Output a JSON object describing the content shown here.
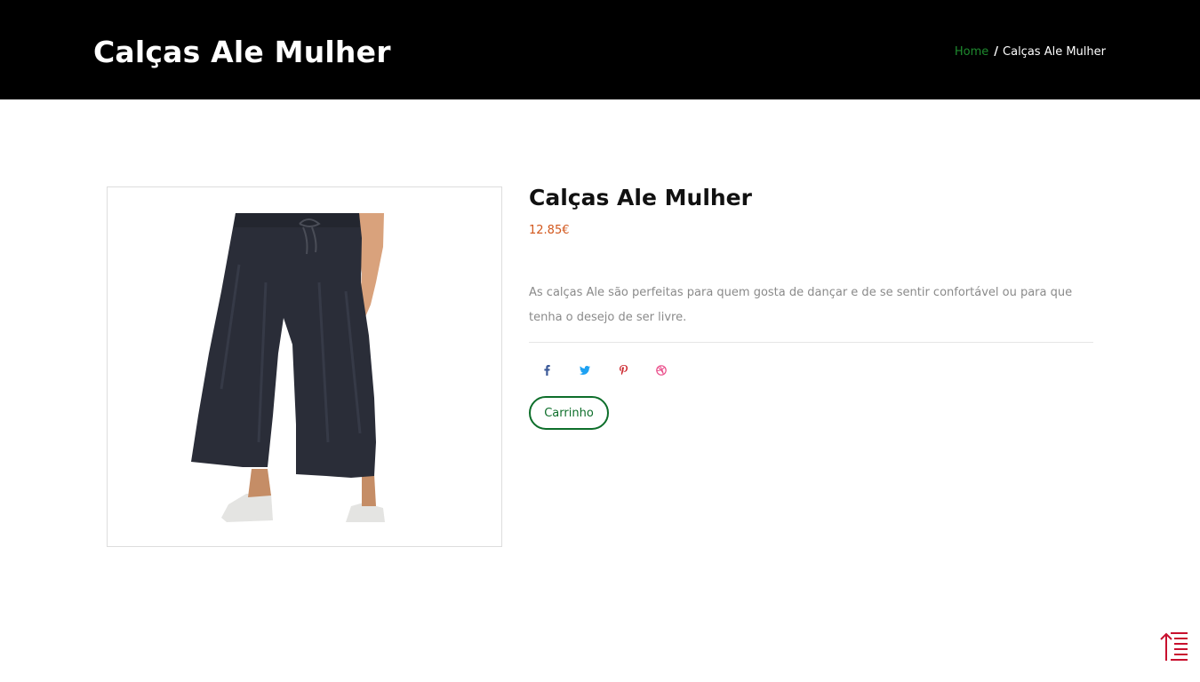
{
  "header": {
    "title": "Calças Ale Mulher",
    "breadcrumb": {
      "home": "Home",
      "separator": "/",
      "current": "Calças Ale Mulher"
    }
  },
  "product": {
    "image_alt": "Calças Ale Mulher",
    "title": "Calças Ale Mulher",
    "price": "12.85€",
    "description": "As calças Ale são perfeitas para quem gosta de dançar e de se sentir confortável ou para que tenha o desejo de ser livre.",
    "social": [
      {
        "icon": "facebook-icon",
        "color": "#3b5998"
      },
      {
        "icon": "twitter-icon",
        "color": "#1da1f2"
      },
      {
        "icon": "pinterest-icon",
        "color": "#cb2027"
      },
      {
        "icon": "dribbble-icon",
        "color": "#ea4c89"
      }
    ],
    "cart_label": "Carrinho"
  },
  "colors": {
    "header_bg": "#000000",
    "breadcrumb_link": "#1e8a2e",
    "price": "#d2571c",
    "button": "#0d6e2a",
    "back_to_top": "#c8102e"
  },
  "back_to_top_icon": "scroll-to-top-icon"
}
